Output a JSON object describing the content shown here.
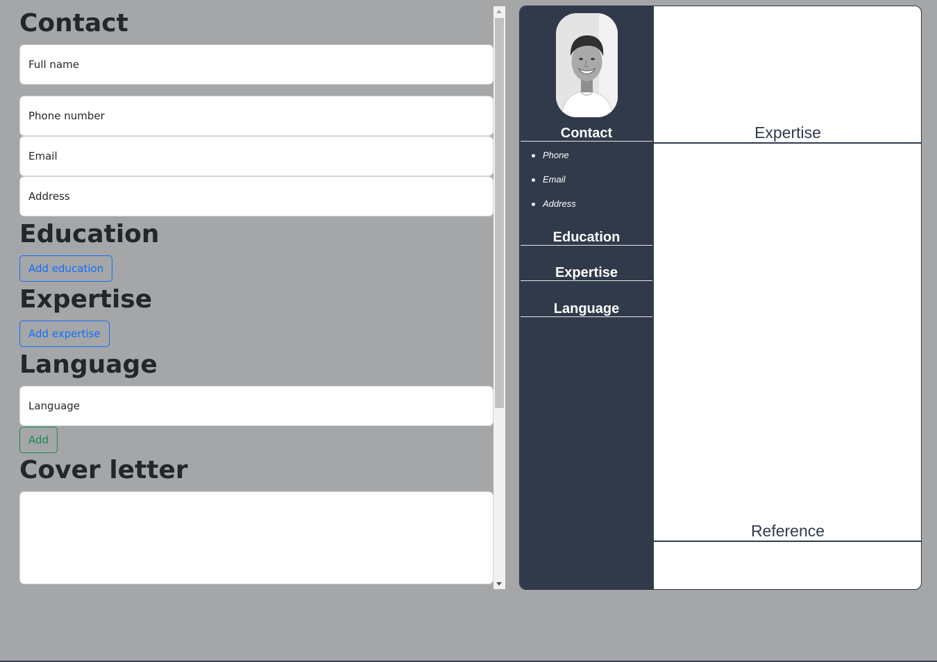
{
  "editor": {
    "contact_title": "Contact",
    "contact_fields": {
      "full_name_placeholder": "Full name",
      "phone_placeholder": "Phone number",
      "email_placeholder": "Email",
      "address_placeholder": "Address"
    },
    "education_title": "Education",
    "add_education_label": "Add education",
    "expertise_title": "Expertise",
    "add_expertise_label": "Add expertise",
    "language_title": "Language",
    "language_placeholder": "Language",
    "add_language_label": "Add",
    "cover_letter_title": "Cover letter",
    "cover_letter_value": ""
  },
  "preview": {
    "sidebar": {
      "contact_heading": "Contact",
      "contact_items": [
        "Phone",
        "Email",
        "Address"
      ],
      "education_heading": "Education",
      "expertise_heading": "Expertise",
      "language_heading": "Language"
    },
    "main": {
      "expertise_heading": "Expertise",
      "reference_heading": "Reference"
    }
  },
  "colors": {
    "page_background": "#a5a6a8",
    "sidebar_background": "#313a4a",
    "primary_button": "#0d6efd",
    "success_button": "#198754",
    "heading_text": "#23262a"
  },
  "icons": {
    "scroll_up": "triangle-up-icon",
    "scroll_down": "triangle-down-icon",
    "profile_photo": "profile-photo"
  }
}
